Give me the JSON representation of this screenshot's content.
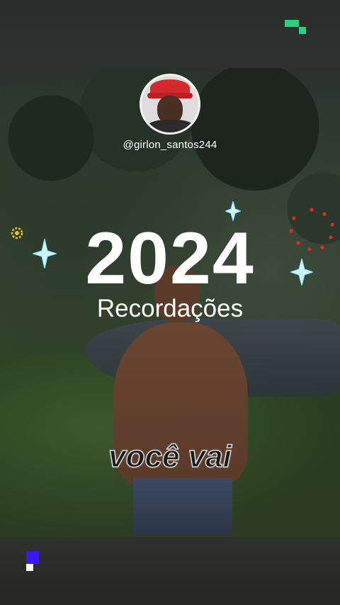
{
  "overlay": {
    "username": "@girlon_santos244",
    "year": "2024",
    "subtitle": "Recordações",
    "caption": "você vai"
  },
  "icons": {
    "top_right": "pixel-blocks-icon",
    "bottom_left": "pixel-blocks-icon",
    "sparkles": [
      "sparkle-icon",
      "sparkle-icon",
      "sparkle-icon"
    ],
    "left_decoration": "sun-gear-icon",
    "right_decoration": "dotted-ring-icon"
  },
  "colors": {
    "text": "#ffffff",
    "top_icon_green": "#22d47a",
    "bottom_icon_blue": "#3d17f2",
    "sparkle_cyan": "#7fe3ff",
    "ring_red": "#e8271f",
    "gear_yellow": "#f0c419"
  }
}
